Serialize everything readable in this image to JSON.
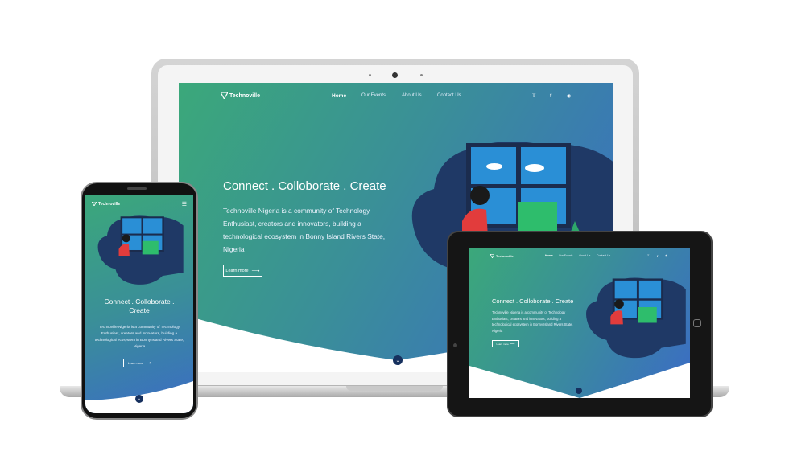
{
  "site": {
    "logo_text": "Technoville",
    "nav": {
      "home": "Home",
      "events": "Our Events",
      "about": "About Us",
      "contact": "Contact Us"
    },
    "social": {
      "twitter": "twitter-icon",
      "facebook": "facebook-icon",
      "instagram": "instagram-icon"
    },
    "hero": {
      "title": "Connect . Colloborate . Create",
      "title_line1": "Connect . Colloborate .",
      "title_line2": "Create",
      "description": "Technoville Nigeria is a community of Technology Enthusiast, creators and innovators, building a technological ecosystem in Bonny Island Rivers State, Nigeria",
      "learn_more": "Learn more"
    }
  },
  "icons": {
    "menu": "hamburger-menu-icon",
    "down": "chevron-down-icon",
    "arrow": "arrow-right-icon"
  },
  "colors": {
    "gradient_start": "#3ba87a",
    "gradient_end": "#3b6bc6",
    "blob": "#1f3966",
    "button_dark": "#16305e"
  }
}
